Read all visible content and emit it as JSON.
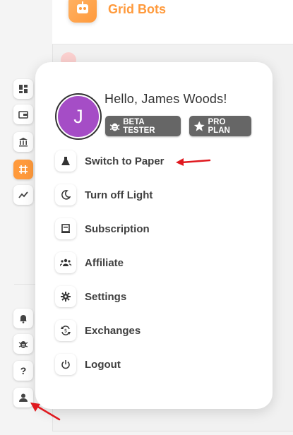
{
  "header": {
    "title": "Grid Bots"
  },
  "sidebar": {
    "top_items": [
      {
        "icon": "dashboard-icon"
      },
      {
        "icon": "wallet-icon"
      },
      {
        "icon": "bank-icon"
      },
      {
        "icon": "grid-icon",
        "active": true
      },
      {
        "icon": "chart-icon"
      }
    ],
    "bottom_items": [
      {
        "icon": "bell-icon"
      },
      {
        "icon": "bug-icon"
      },
      {
        "icon": "help-icon",
        "label": "?"
      },
      {
        "icon": "user-icon"
      }
    ]
  },
  "menu": {
    "avatar_initial": "J",
    "greeting": "Hello, James Woods!",
    "badges": {
      "beta": "BETA TESTER",
      "pro": "PRO PLAN"
    },
    "items": [
      {
        "label": "Switch to Paper",
        "icon": "flask-icon"
      },
      {
        "label": "Turn off Light",
        "icon": "moon-icon"
      },
      {
        "label": "Subscription",
        "icon": "receipt-icon"
      },
      {
        "label": "Affiliate",
        "icon": "people-icon"
      },
      {
        "label": "Settings",
        "icon": "gear-icon"
      },
      {
        "label": "Exchanges",
        "icon": "exchange-icon"
      },
      {
        "label": "Logout",
        "icon": "power-icon"
      }
    ]
  },
  "colors": {
    "accent": "#ff9a3c",
    "avatar": "#a54dc6",
    "badge": "#666666",
    "annotation_arrow": "#e0191f"
  }
}
